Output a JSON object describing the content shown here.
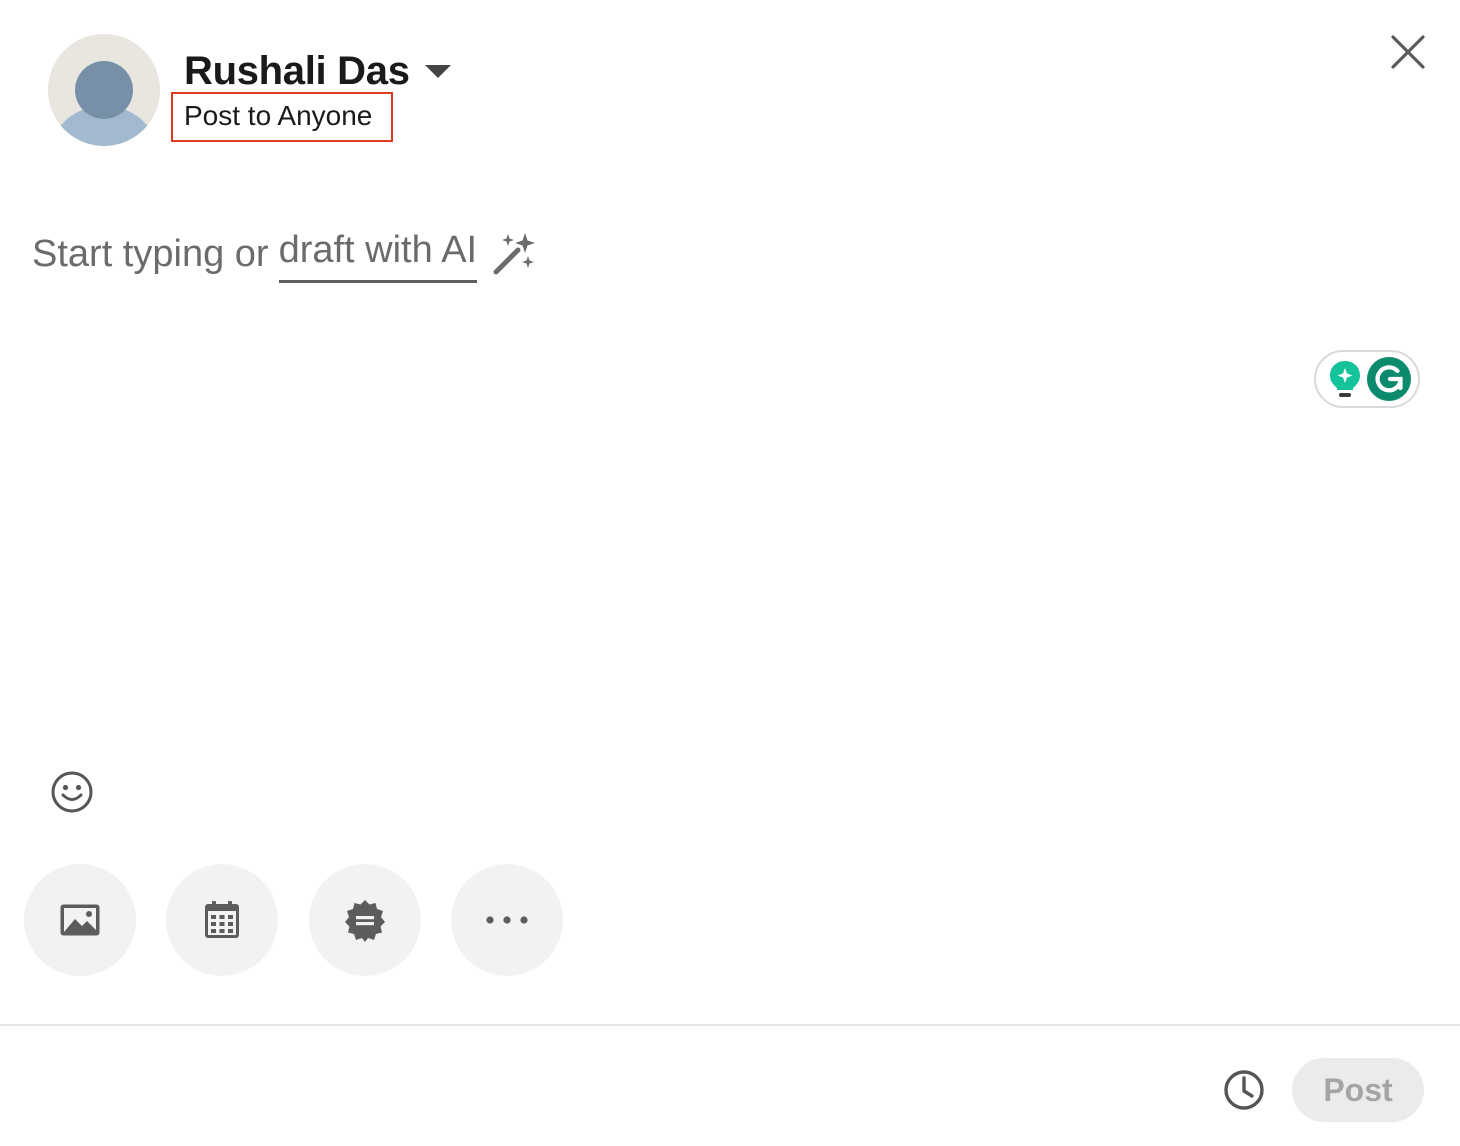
{
  "header": {
    "author_name": "Rushali Das",
    "audience": "Post to Anyone",
    "highlight_color": "#dd3b1f"
  },
  "editor": {
    "placeholder_prefix": "Start typing or",
    "ai_link": "draft with AI",
    "ai_icon": "magic-wand-sparkles-icon"
  },
  "grammarly": {
    "icons": [
      "lightbulb-sparkle-icon",
      "grammarly-g-icon"
    ],
    "accent": "#15c39a",
    "brand": "#0b8a6e"
  },
  "toolbar": {
    "emoji_icon": "emoji-smiley-icon",
    "tools": [
      {
        "icon": "image-icon"
      },
      {
        "icon": "calendar-icon"
      },
      {
        "icon": "badge-icon"
      },
      {
        "icon": "more-icon"
      }
    ]
  },
  "footer": {
    "schedule_icon": "clock-icon",
    "post_label": "Post"
  }
}
